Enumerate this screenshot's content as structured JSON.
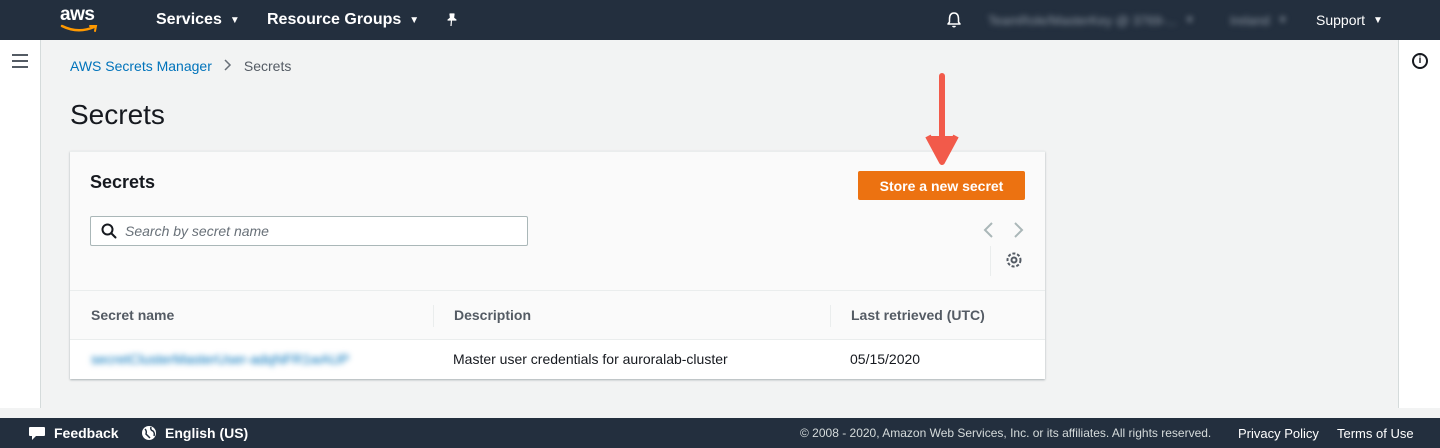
{
  "nav": {
    "logo": "aws",
    "services": "Services",
    "resource_groups": "Resource Groups",
    "account": "TeamRole/MasterKey @ 3769-...",
    "region": "Ireland",
    "support": "Support"
  },
  "breadcrumb": {
    "root": "AWS Secrets Manager",
    "current": "Secrets"
  },
  "page_title": "Secrets",
  "panel": {
    "title": "Secrets",
    "store_button": "Store a new secret",
    "search_placeholder": "Search by secret name"
  },
  "table": {
    "columns": [
      "Secret name",
      "Description",
      "Last retrieved (UTC)"
    ],
    "rows": [
      {
        "name": "secretClusterMasterUser-adqNFR1wAUP",
        "description": "Master user credentials for auroralab-cluster",
        "last_retrieved": "05/15/2020"
      }
    ]
  },
  "footer": {
    "feedback": "Feedback",
    "language": "English (US)",
    "copyright": "© 2008 - 2020, Amazon Web Services, Inc. or its affiliates. All rights reserved.",
    "privacy": "Privacy Policy",
    "terms": "Terms of Use"
  },
  "colors": {
    "nav_bg": "#232f3e",
    "primary": "#ec7211",
    "link": "#0073bb",
    "annotation": "#f25a4a"
  }
}
